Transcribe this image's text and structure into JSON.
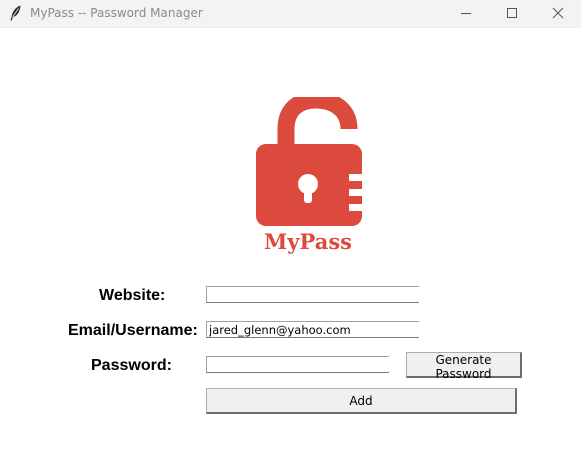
{
  "window": {
    "title": "MyPass -- Password Manager",
    "icon": "feather-icon"
  },
  "logo": {
    "text": "MyPass",
    "icon": "open-padlock-icon",
    "color": "#db4a3c"
  },
  "form": {
    "website_label": "Website:",
    "website_value": "",
    "email_label": "Email/Username:",
    "email_value": "jared_glenn@yahoo.com",
    "password_label": "Password:",
    "password_value": "",
    "generate_label": "Generate Password",
    "add_label": "Add"
  }
}
